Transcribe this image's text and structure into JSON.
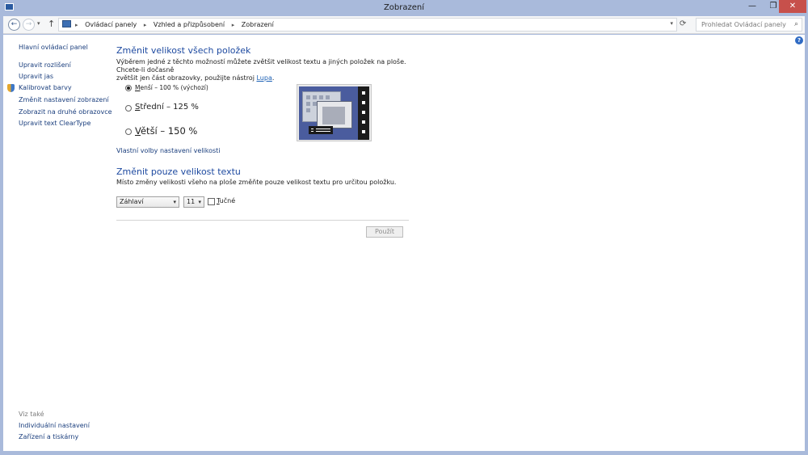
{
  "window": {
    "title": "Zobrazení",
    "min_glyph": "—",
    "max_glyph": "❐",
    "close_glyph": "✕"
  },
  "addressbar": {
    "back_glyph": "←",
    "forward_glyph": "→",
    "recent_glyph": "▾",
    "up_glyph": "↑",
    "separator_glyph": "▸",
    "crumbs": [
      "Ovládací panely",
      "Vzhled a přizpůsobení",
      "Zobrazení"
    ],
    "dropdown_glyph": "▾",
    "refresh_glyph": "⟳",
    "search_placeholder": "Prohledat Ovládací panely",
    "search_glyph": "⌕"
  },
  "help": {
    "glyph": "?"
  },
  "left_nav": {
    "home": "Hlavní ovládací panel",
    "items": [
      "Upravit rozlišení",
      "Upravit jas",
      "Kalibrovat barvy",
      "Změnit nastavení zobrazení",
      "Zobrazit na druhé obrazovce",
      "Upravit text ClearType"
    ],
    "see_also_title": "Viz také",
    "see_also": [
      "Individuální nastavení",
      "Zařízení a tiskárny"
    ]
  },
  "main": {
    "heading": "Změnit velikost všech položek",
    "description_line1": "Výběrem jedné z těchto možností můžete zvětšit velikost textu a jiných položek na ploše. Chcete-li dočasně",
    "description_line2": "zvětšit jen část obrazovky, použijte nástroj",
    "magnifier_link": "Lupa",
    "description_end": ".",
    "options": [
      {
        "accesskey": "M",
        "rest": "enší – 100 % (výchozí)",
        "checked": true
      },
      {
        "accesskey": "S",
        "rest": "třední – 125 %",
        "checked": false
      },
      {
        "accesskey": "V",
        "rest": "ětší – 150 %",
        "checked": false
      }
    ],
    "custom_link": "Vlastní volby nastavení velikosti",
    "heading2": "Změnit pouze velikost textu",
    "description2": "Místo změny velikosti všeho na ploše změňte pouze velikost textu pro určitou položku.",
    "item_select_value": "Záhlaví",
    "size_select_value": "11",
    "bold_accesskey": "T",
    "bold_rest": "učné",
    "bold_checked": false,
    "apply_button": "Použít"
  }
}
